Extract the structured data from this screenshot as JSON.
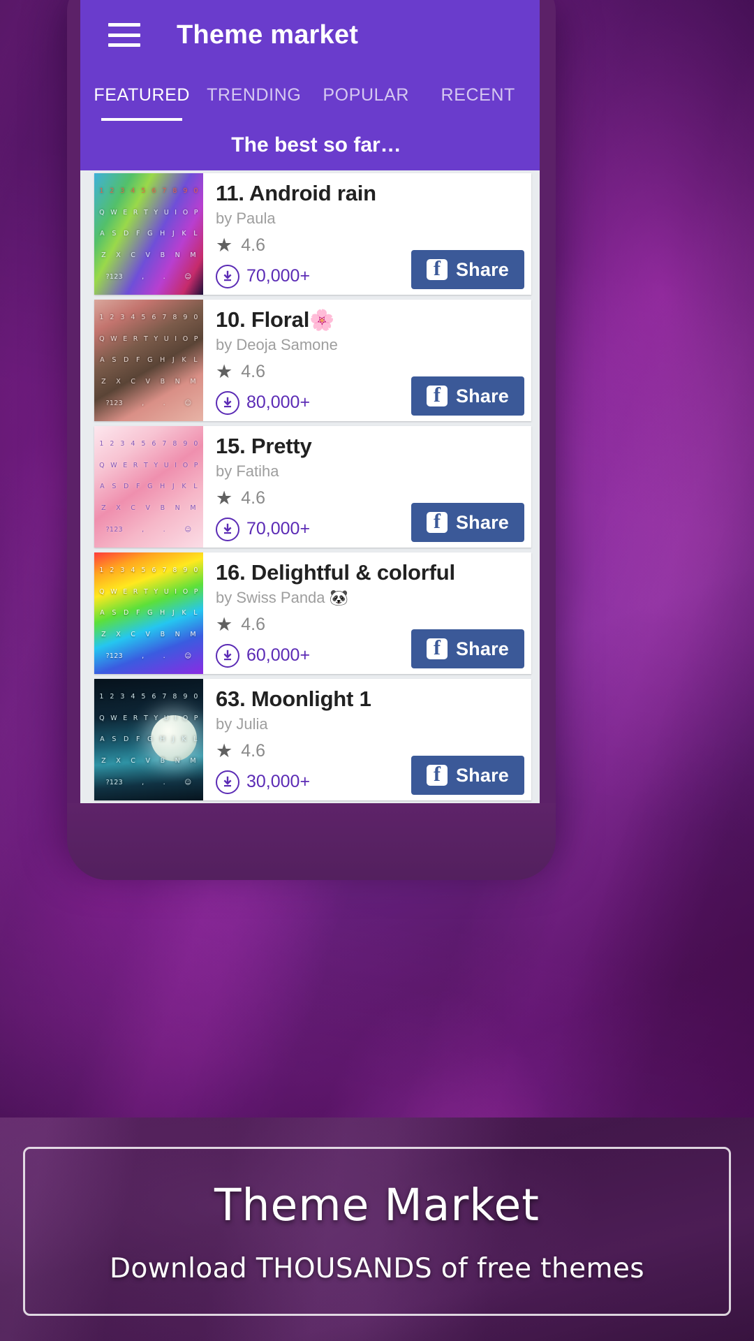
{
  "app": {
    "menu_icon": "hamburger-menu-icon",
    "title": "Theme market",
    "subtitle": "The best so far…"
  },
  "tabs": [
    {
      "label": "FEATURED",
      "active": true
    },
    {
      "label": "TRENDING",
      "active": false
    },
    {
      "label": "POPULAR",
      "active": false
    },
    {
      "label": "RECENT",
      "active": false
    }
  ],
  "share": {
    "label": "Share",
    "icon": "facebook-icon",
    "color": "#3b5998"
  },
  "icons": {
    "star": "star-icon",
    "download": "download-circle-icon"
  },
  "themes": [
    {
      "title": "11. Android rain",
      "emoji": "",
      "author": "by Paula",
      "rating": "4.6",
      "downloads": "70,000+",
      "thumb_class": "kb-rain",
      "thumb_name": "theme-thumbnail-android-rain"
    },
    {
      "title": "10. Floral",
      "emoji": "🌸",
      "author": "by Deoja Samone",
      "rating": "4.6",
      "downloads": "80,000+",
      "thumb_class": "kb-floral",
      "thumb_name": "theme-thumbnail-floral"
    },
    {
      "title": "15. Pretty",
      "emoji": "",
      "author": "by Fatiha",
      "rating": "4.6",
      "downloads": "70,000+",
      "thumb_class": "kb-pretty",
      "thumb_name": "theme-thumbnail-pretty"
    },
    {
      "title": "16. Delightful & colorful",
      "emoji": "",
      "author": "by Swiss Panda 🐼",
      "rating": "4.6",
      "downloads": "60,000+",
      "thumb_class": "kb-color",
      "thumb_name": "theme-thumbnail-delightful-colorful"
    },
    {
      "title": "63. Moonlight 1",
      "emoji": "",
      "author": "by Julia",
      "rating": "4.6",
      "downloads": "30,000+",
      "thumb_class": "kb-moon",
      "thumb_name": "theme-thumbnail-moonlight-1"
    }
  ],
  "keyboard_rows": [
    "1 2 3 4 5 6 7 8 9 0",
    "Q W E R T Y U I O P",
    "A S D F G H J K L",
    "Z X C V B N M",
    "?123  ,   .   ☺"
  ],
  "promo": {
    "title": "Theme Market",
    "subtitle": "Download  THOUSANDS  of free themes"
  },
  "colors": {
    "appbar": "#6a3ccc",
    "accent": "#5b2bb5",
    "facebook": "#3b5998",
    "background": "#7a1f8f"
  }
}
